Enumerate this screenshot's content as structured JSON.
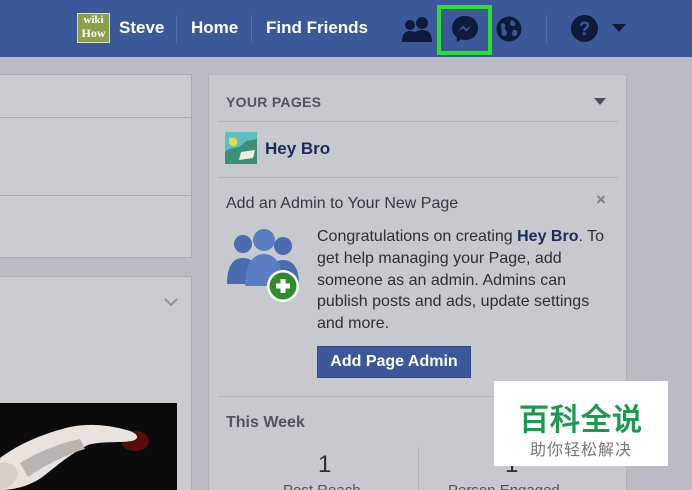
{
  "topbar": {
    "logo_line1": "wiki",
    "logo_line2": "How",
    "user_name": "Steve",
    "home_label": "Home",
    "find_friends_label": "Find Friends"
  },
  "your_pages": {
    "heading": "YOUR PAGES",
    "page_name": "Hey Bro"
  },
  "admin_panel": {
    "title": "Add an Admin to Your New Page",
    "close_symbol": "×",
    "desc_prefix": "Congratulations on creating ",
    "desc_page": "Hey Bro",
    "desc_suffix": ". To get help managing your Page, add someone as an admin. Admins can publish posts and ads, update settings and more.",
    "button_label": "Add Page Admin"
  },
  "this_week": {
    "heading": "This Week",
    "stats": [
      {
        "value": "1",
        "label": "Post Reach"
      },
      {
        "value": "1",
        "label": "Person Engaged"
      }
    ]
  },
  "watermark": {
    "main": "百科全说",
    "sub": "助你轻松解决"
  },
  "colors": {
    "brand": "#3b5998",
    "highlight": "#27e32a",
    "watermark_green": "#1a9a4e"
  },
  "icons": [
    "friends-icon",
    "messenger-icon",
    "globe-icon",
    "help-icon",
    "admin-people-icon",
    "chevron-down-icon"
  ]
}
